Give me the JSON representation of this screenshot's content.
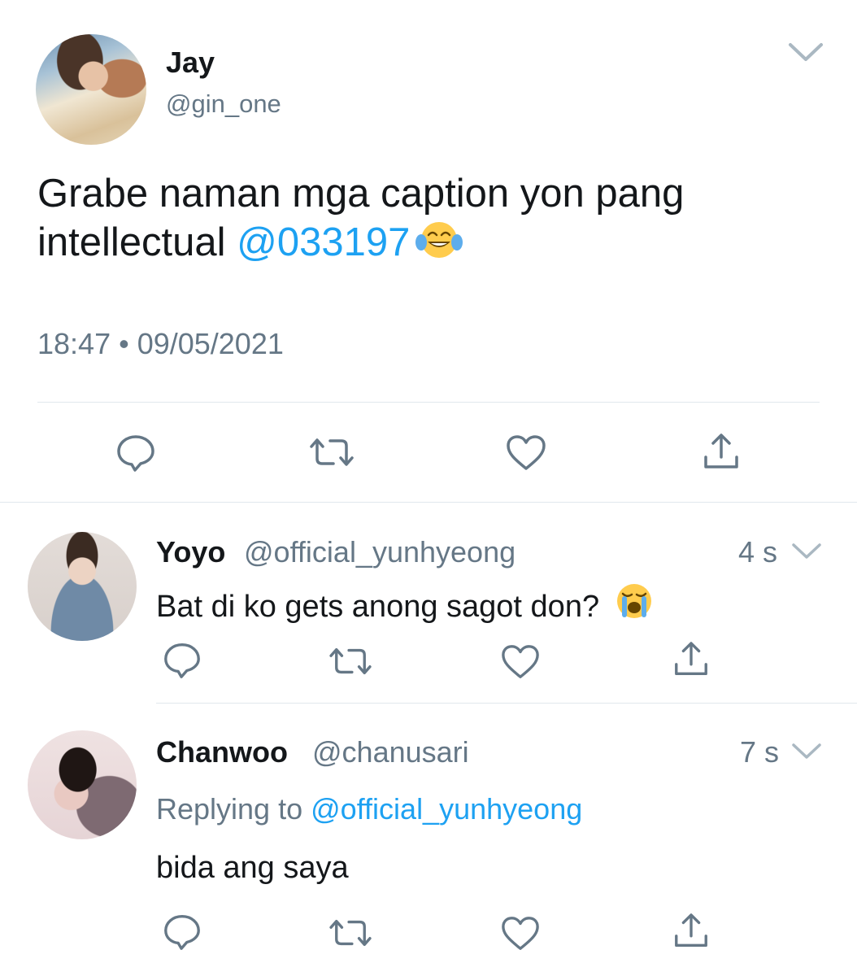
{
  "main_tweet": {
    "author_name": "Jay",
    "author_handle": "@gin_one",
    "text_before": "Grabe naman mga caption yon pang intellectual",
    "mention": "@033197",
    "emoji": "face-with-tears-of-joy",
    "timestamp": "18:47 • 09/05/2021"
  },
  "replies": [
    {
      "author_name": "Yoyo",
      "author_handle": "@official_yunhyeong",
      "time": "4 s",
      "text": "Bat di ko gets anong sagot don?",
      "emoji": "loudly-crying-face"
    },
    {
      "author_name": "Chanwoo",
      "author_handle": "@chanusari",
      "time": "7 s",
      "replying_prefix": "Replying to",
      "replying_to": "@official_yunhyeong",
      "text": "bida ang saya"
    }
  ],
  "colors": {
    "link": "#1da1f2",
    "secondary_text": "#657786",
    "icon": "#657786",
    "divider": "#e1e8ed"
  },
  "icons": [
    "chevron-down-icon",
    "reply-icon",
    "retweet-icon",
    "like-icon",
    "share-icon"
  ]
}
